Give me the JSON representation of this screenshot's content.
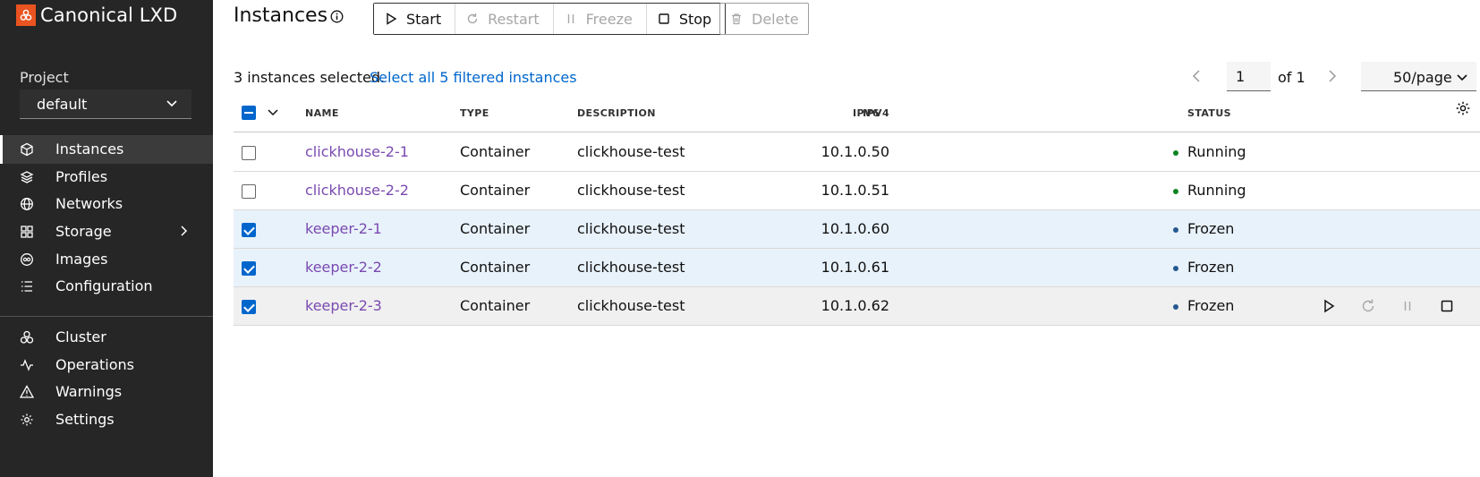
{
  "app": {
    "title": "Canonical LXD",
    "brand_color": "#e95420"
  },
  "sidebar": {
    "project_label": "Project",
    "project_value": "default",
    "items": [
      {
        "label": "Instances",
        "icon": "instances-icon",
        "active": true
      },
      {
        "label": "Profiles",
        "icon": "profiles-icon"
      },
      {
        "label": "Networks",
        "icon": "networks-icon"
      },
      {
        "label": "Storage",
        "icon": "storage-icon",
        "expandable": true
      },
      {
        "label": "Images",
        "icon": "images-icon"
      },
      {
        "label": "Configuration",
        "icon": "configuration-icon"
      },
      {
        "label": "Cluster",
        "icon": "cluster-icon"
      },
      {
        "label": "Operations",
        "icon": "operations-icon"
      },
      {
        "label": "Warnings",
        "icon": "warnings-icon"
      },
      {
        "label": "Settings",
        "icon": "settings-icon"
      }
    ]
  },
  "header": {
    "title": "Instances",
    "buttons": {
      "start": "Start",
      "restart": "Restart",
      "freeze": "Freeze",
      "stop": "Stop",
      "delete": "Delete"
    }
  },
  "selection": {
    "info": "3 instances selected.",
    "select_all": "Select all 5 filtered instances"
  },
  "pagination": {
    "page": "1",
    "of": "of 1",
    "per_page": "50/page"
  },
  "table": {
    "headers": {
      "name": "NAME",
      "type": "TYPE",
      "description": "DESCRIPTION",
      "ipv4": "IPV4",
      "ipv6": "IPV6",
      "status": "STATUS"
    },
    "rows": [
      {
        "name": "clickhouse-2-1",
        "type": "Container",
        "description": "clickhouse-test",
        "ipv4": "10.1.0.50",
        "status": "Running",
        "selected": false
      },
      {
        "name": "clickhouse-2-2",
        "type": "Container",
        "description": "clickhouse-test",
        "ipv4": "10.1.0.51",
        "status": "Running",
        "selected": false
      },
      {
        "name": "keeper-2-1",
        "type": "Container",
        "description": "clickhouse-test",
        "ipv4": "10.1.0.60",
        "status": "Frozen",
        "selected": true
      },
      {
        "name": "keeper-2-2",
        "type": "Container",
        "description": "clickhouse-test",
        "ipv4": "10.1.0.61",
        "status": "Frozen",
        "selected": true
      },
      {
        "name": "keeper-2-3",
        "type": "Container",
        "description": "clickhouse-test",
        "ipv4": "10.1.0.62",
        "status": "Frozen",
        "selected": true
      }
    ]
  },
  "colors": {
    "running": "#0e8420",
    "frozen": "#24598f",
    "link": "#0066cc",
    "instance_name": "#7a4ab0"
  }
}
